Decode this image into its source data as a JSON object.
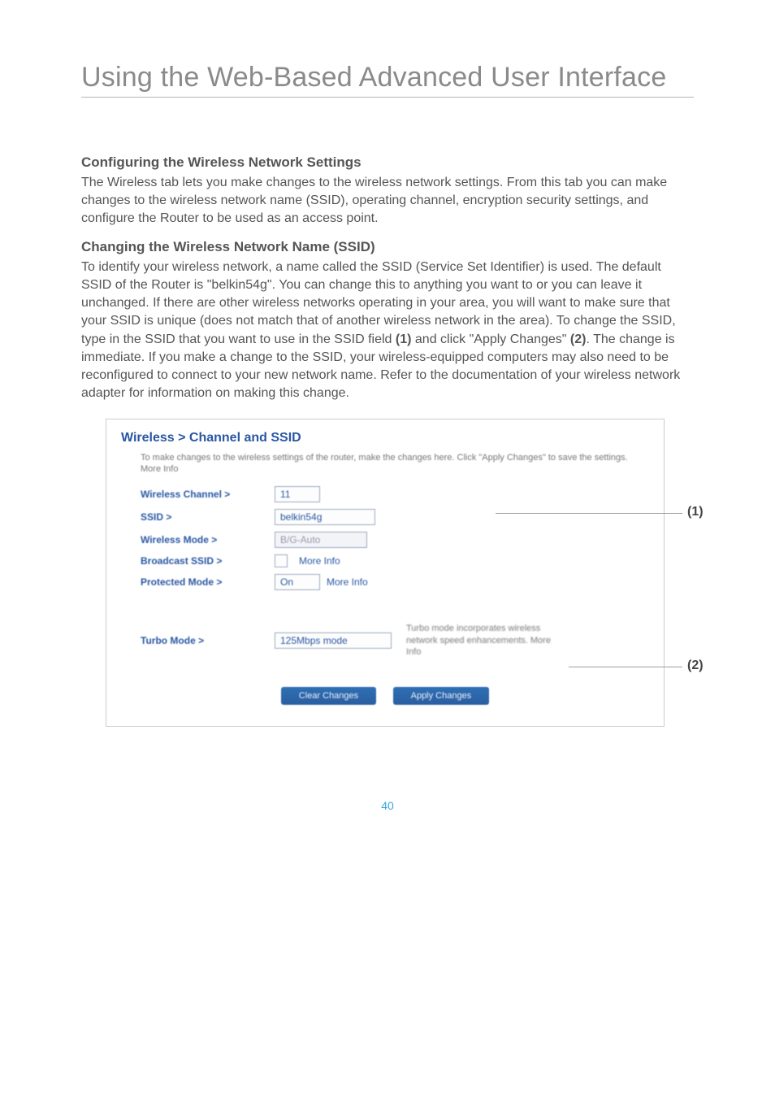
{
  "page": {
    "title": "Using the Web-Based Advanced User Interface",
    "number": "40"
  },
  "sections": {
    "config_heading": "Configuring the Wireless Network Settings",
    "config_body": "The Wireless tab lets you make changes to the wireless network settings. From this tab you can make changes to the wireless network name (SSID), operating channel, encryption security settings, and configure the Router to be used as an access point.",
    "ssid_heading": "Changing the Wireless Network Name (SSID)",
    "ssid_body_pre": "To identify your wireless network, a name called the SSID (Service Set Identifier) is used. The default SSID of the Router is \"belkin54g\". You can change this to anything you want to or you can leave it unchanged. If there are other wireless networks operating in your area, you will want to make sure that your SSID is unique (does not match that of another wireless network in the area). To change the SSID, type in the SSID that you want to use in the SSID field ",
    "marker1": "(1)",
    "ssid_body_mid": " and click \"Apply Changes\" ",
    "marker2": "(2)",
    "ssid_body_post": ". The change is immediate. If you make a change to the SSID, your wireless-equipped computers may also need to be reconfigured to connect to your new network name. Refer to the documentation of your wireless network adapter for information on making this change."
  },
  "panel": {
    "title": "Wireless > Channel and SSID",
    "desc": "To make changes to the wireless settings of the router, make the changes here. Click \"Apply Changes\" to save the settings. More Info",
    "rows": {
      "channel_label": "Wireless Channel >",
      "channel_value": "11",
      "ssid_label": "SSID >",
      "ssid_value": "belkin54g",
      "mode_label": "Wireless Mode >",
      "mode_value": "B/G-Auto",
      "bssid_label": "Broadcast SSID >",
      "bssid_more": "More Info",
      "pmode_label": "Protected Mode >",
      "pmode_value": "On",
      "pmode_more": "More Info",
      "turbo_label": "Turbo Mode >",
      "turbo_value": "125Mbps mode",
      "turbo_desc": "Turbo mode incorporates wireless network speed enhancements. More Info"
    },
    "buttons": {
      "clear": "Clear Changes",
      "apply": "Apply Changes"
    }
  },
  "callouts": {
    "one": "(1)",
    "two": "(2)"
  }
}
